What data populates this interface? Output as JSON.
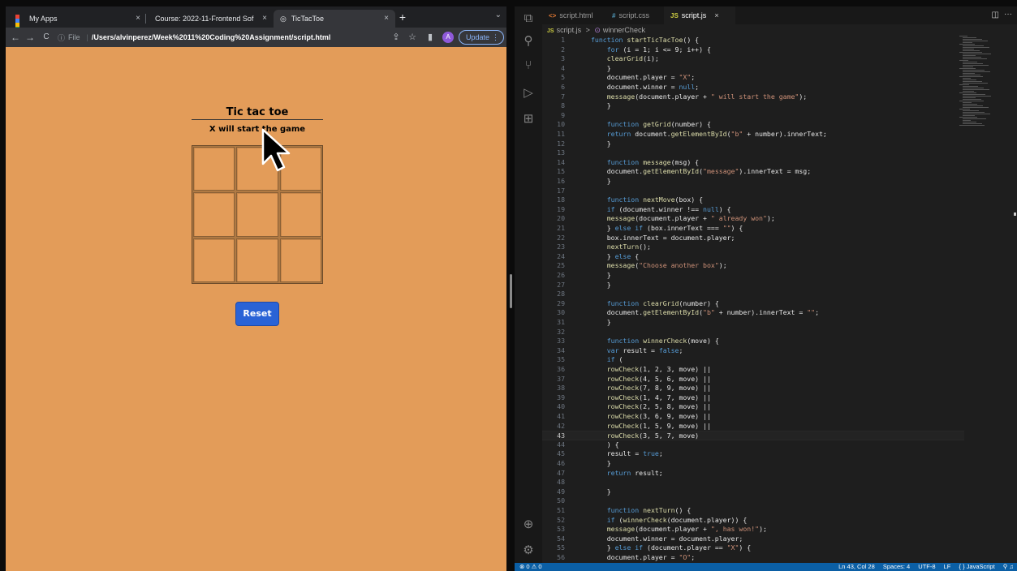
{
  "browser": {
    "tabs": [
      {
        "label": "My Apps",
        "close": "×"
      },
      {
        "label": "Course: 2022-11-Frontend Sof",
        "close": "×"
      },
      {
        "label": "TicTacToe",
        "close": "×"
      }
    ],
    "new_tab": "+",
    "tab_menu": "⌄",
    "nav": {
      "back": "←",
      "forward": "→",
      "reload": "C"
    },
    "address": {
      "info": "ⓘ",
      "scheme_label": "File",
      "separator": "|",
      "url": "/Users/alvinperez/Week%2011%20Coding%20Assignment/script.html"
    },
    "toolbar_icons": {
      "share": "⇪",
      "star": "☆",
      "sidepanel": "▮"
    },
    "avatar_letter": "A",
    "update_label": "Update",
    "update_menu": "⋮"
  },
  "game": {
    "title": "Tic tac toe",
    "message": "X will start the game",
    "cells": [
      "",
      "",
      "",
      "",
      "",
      "",
      "",
      "",
      ""
    ],
    "reset_label": "Reset"
  },
  "editor": {
    "tabs": [
      {
        "icon": "<>",
        "label": "script.html"
      },
      {
        "icon": "#",
        "label": "script.css"
      },
      {
        "icon": "JS",
        "label": "script.js",
        "close": "×"
      }
    ],
    "split_icon": "◫",
    "more_icon": "···",
    "breadcrumb": {
      "icon": "JS",
      "file": "script.js",
      "sep": ">",
      "symbol_icon": "⊙",
      "symbol": "winnerCheck"
    },
    "activity_icons": [
      "⧉",
      "⚲",
      "⑂",
      "▷",
      "⊞",
      "⊕",
      "⚙"
    ],
    "lines": [
      {
        "n": "1",
        "t": "function startTicTacToe() {"
      },
      {
        "n": "2",
        "t": "    for (i = 1; i <= 9; i++) {"
      },
      {
        "n": "3",
        "t": "    clearGrid(i);"
      },
      {
        "n": "4",
        "t": "    }"
      },
      {
        "n": "5",
        "t": "    document.player = \"X\";"
      },
      {
        "n": "6",
        "t": "    document.winner = null;"
      },
      {
        "n": "7",
        "t": "    message(document.player + \" will start the game\");"
      },
      {
        "n": "8",
        "t": "    }"
      },
      {
        "n": "9",
        "t": ""
      },
      {
        "n": "10",
        "t": "    function getGrid(number) {"
      },
      {
        "n": "11",
        "t": "    return document.getElementById(\"b\" + number).innerText;"
      },
      {
        "n": "12",
        "t": "    }"
      },
      {
        "n": "13",
        "t": ""
      },
      {
        "n": "14",
        "t": "    function message(msg) {"
      },
      {
        "n": "15",
        "t": "    document.getElementById(\"message\").innerText = msg;"
      },
      {
        "n": "16",
        "t": "    }"
      },
      {
        "n": "17",
        "t": ""
      },
      {
        "n": "18",
        "t": "    function nextMove(box) {"
      },
      {
        "n": "19",
        "t": "    if (document.winner !== null) {"
      },
      {
        "n": "20",
        "t": "    message(document.player + \" already won\");"
      },
      {
        "n": "21",
        "t": "    } else if (box.innerText === \"\") {"
      },
      {
        "n": "22",
        "t": "    box.innerText = document.player;"
      },
      {
        "n": "23",
        "t": "    nextTurn();"
      },
      {
        "n": "24",
        "t": "    } else {"
      },
      {
        "n": "25",
        "t": "    message(\"Choose another box\");"
      },
      {
        "n": "26",
        "t": "    }"
      },
      {
        "n": "27",
        "t": "    }"
      },
      {
        "n": "28",
        "t": ""
      },
      {
        "n": "29",
        "t": "    function clearGrid(number) {"
      },
      {
        "n": "30",
        "t": "    document.getElementById(\"b\" + number).innerText = \"\";"
      },
      {
        "n": "31",
        "t": "    }"
      },
      {
        "n": "32",
        "t": ""
      },
      {
        "n": "33",
        "t": "    function winnerCheck(move) {"
      },
      {
        "n": "34",
        "t": "    var result = false;"
      },
      {
        "n": "35",
        "t": "    if ("
      },
      {
        "n": "36",
        "t": "    rowCheck(1, 2, 3, move) ||"
      },
      {
        "n": "37",
        "t": "    rowCheck(4, 5, 6, move) ||"
      },
      {
        "n": "38",
        "t": "    rowCheck(7, 8, 9, move) ||"
      },
      {
        "n": "39",
        "t": "    rowCheck(1, 4, 7, move) ||"
      },
      {
        "n": "40",
        "t": "    rowCheck(2, 5, 8, move) ||"
      },
      {
        "n": "41",
        "t": "    rowCheck(3, 6, 9, move) ||"
      },
      {
        "n": "42",
        "t": "    rowCheck(1, 5, 9, move) ||"
      },
      {
        "n": "43",
        "t": "    rowCheck(3, 5, 7, move)"
      },
      {
        "n": "44",
        "t": "    ) {"
      },
      {
        "n": "45",
        "t": "    result = true;"
      },
      {
        "n": "46",
        "t": "    }"
      },
      {
        "n": "47",
        "t": "    return result;"
      },
      {
        "n": "48",
        "t": ""
      },
      {
        "n": "49",
        "t": "    }"
      },
      {
        "n": "50",
        "t": ""
      },
      {
        "n": "51",
        "t": "    function nextTurn() {"
      },
      {
        "n": "52",
        "t": "    if (winnerCheck(document.player)) {"
      },
      {
        "n": "53",
        "t": "    message(document.player + \", has won!\");"
      },
      {
        "n": "54",
        "t": "    document.winner = document.player;"
      },
      {
        "n": "55",
        "t": "    } else if (document.player == \"X\") {"
      },
      {
        "n": "56",
        "t": "    document.player = \"O\";"
      }
    ],
    "active_line": "43",
    "status": {
      "left": "⊗ 0 ⚠ 0",
      "position": "Ln 43, Col 28",
      "spaces": "Spaces: 4",
      "encoding": "UTF-8",
      "eol": "LF",
      "language": "{ } JavaScript",
      "icons": "⚲ ♫"
    }
  },
  "colors": {
    "page_bg": "#e39c59",
    "reset_button": "#2a63d6",
    "editor_bg": "#1e1e1e",
    "statusbar": "#0b5fa5",
    "keyword": "#569cd6",
    "function": "#dcdcaa",
    "string": "#ce9178"
  }
}
